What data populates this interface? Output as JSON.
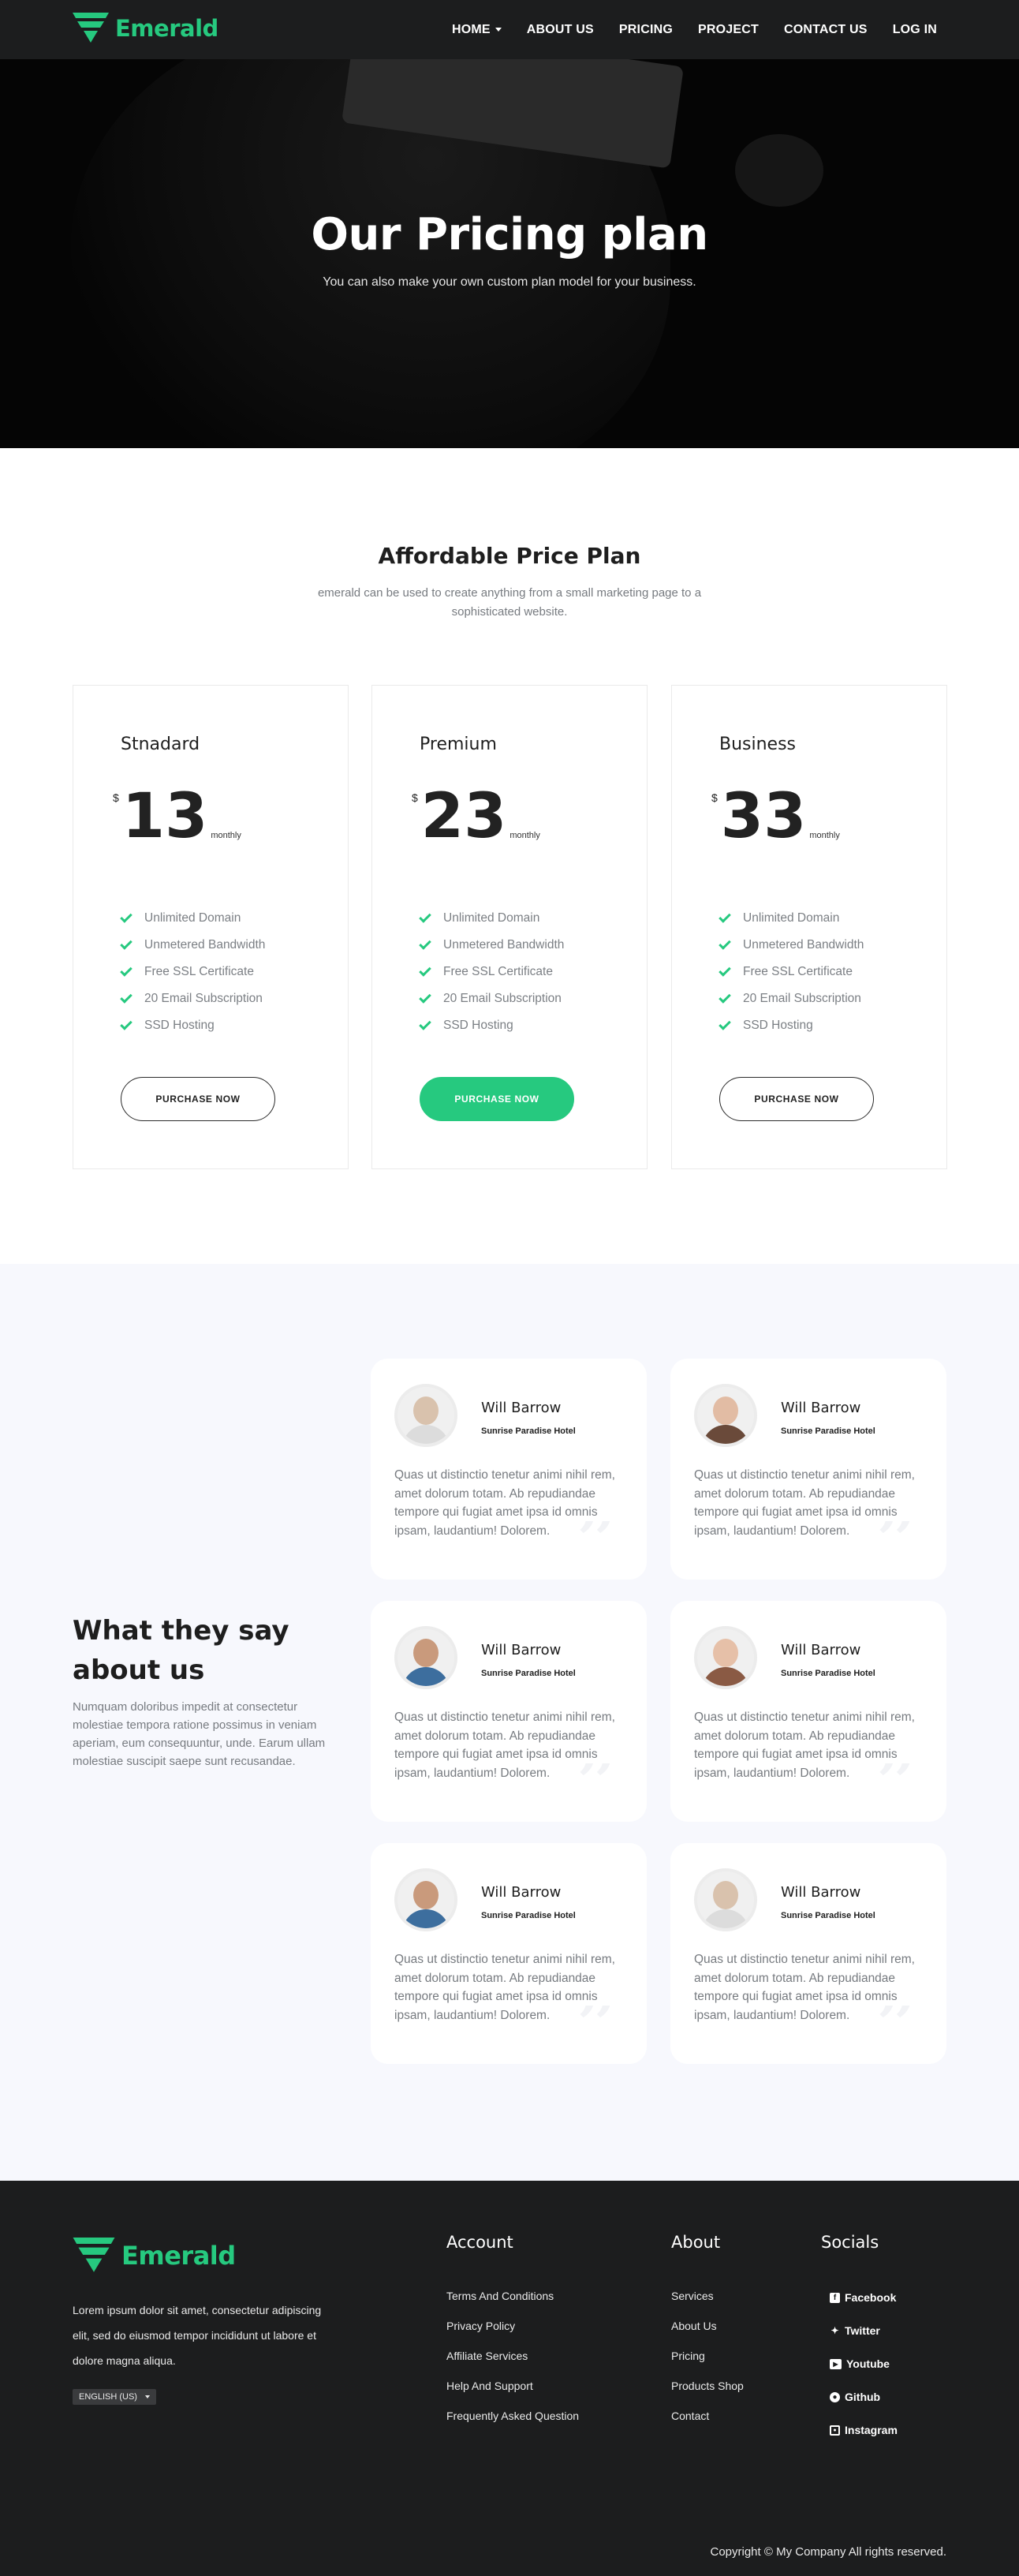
{
  "brand": {
    "name": "Emerald",
    "color": "#26c97f",
    "icon": "emerald-logo-icon"
  },
  "nav": {
    "items": [
      "HOME",
      "ABOUT US",
      "PRICING",
      "PROJECT",
      "CONTACT US",
      "LOG IN"
    ]
  },
  "hero": {
    "title": "Our Pricing plan",
    "subtitle": "You can also make your own custom plan model for your business."
  },
  "pricing": {
    "heading": "Affordable Price Plan",
    "description": "emerald can be used to create anything from a small marketing page to a sophisticated website.",
    "plans": [
      {
        "name": "Stnadard",
        "currency": "$",
        "amount": "13",
        "period": "monthly",
        "features": [
          "Unlimited Domain",
          "Unmetered Bandwidth",
          "Free SSL Certificate",
          "20 Email Subscription",
          "SSD Hosting"
        ],
        "button": "PURCHASE NOW",
        "highlight": false
      },
      {
        "name": "Premium",
        "currency": "$",
        "amount": "23",
        "period": "monthly",
        "features": [
          "Unlimited Domain",
          "Unmetered Bandwidth",
          "Free SSL Certificate",
          "20 Email Subscription",
          "SSD Hosting"
        ],
        "button": "PURCHASE NOW",
        "highlight": true
      },
      {
        "name": "Business",
        "currency": "$",
        "amount": "33",
        "period": "monthly",
        "features": [
          "Unlimited Domain",
          "Unmetered Bandwidth",
          "Free SSL Certificate",
          "20 Email Subscription",
          "SSD Hosting"
        ],
        "button": "PURCHASE NOW",
        "highlight": false
      }
    ]
  },
  "testimonials": {
    "title": "What they say about us",
    "description": "Numquam doloribus impedit at consectetur molestiae tempora ratione possimus in veniam aperiam, eum consequuntur, unde. Earum ullam molestiae suscipit saepe sunt recusandae.",
    "cards": [
      {
        "name": "Will Barrow",
        "hotel": "Sunrise Paradise Hotel",
        "quote": "Quas ut distinctio tenetur animi nihil rem, amet dolorum totam. Ab repudiandae tempore qui fugiat amet ipsa id omnis ipsam, laudantium! Dolorem.",
        "avatar": "person-avatar-1"
      },
      {
        "name": "Will Barrow",
        "hotel": "Sunrise Paradise Hotel",
        "quote": "Quas ut distinctio tenetur animi nihil rem, amet dolorum totam. Ab repudiandae tempore qui fugiat amet ipsa id omnis ipsam, laudantium! Dolorem.",
        "avatar": "person-avatar-2"
      },
      {
        "name": "Will Barrow",
        "hotel": "Sunrise Paradise Hotel",
        "quote": "Quas ut distinctio tenetur animi nihil rem, amet dolorum totam. Ab repudiandae tempore qui fugiat amet ipsa id omnis ipsam, laudantium! Dolorem.",
        "avatar": "person-avatar-3"
      },
      {
        "name": "Will Barrow",
        "hotel": "Sunrise Paradise Hotel",
        "quote": "Quas ut distinctio tenetur animi nihil rem, amet dolorum totam. Ab repudiandae tempore qui fugiat amet ipsa id omnis ipsam, laudantium! Dolorem.",
        "avatar": "person-avatar-4"
      },
      {
        "name": "Will Barrow",
        "hotel": "Sunrise Paradise Hotel",
        "quote": "Quas ut distinctio tenetur animi nihil rem, amet dolorum totam. Ab repudiandae tempore qui fugiat amet ipsa id omnis ipsam, laudantium! Dolorem.",
        "avatar": "person-avatar-5"
      },
      {
        "name": "Will Barrow",
        "hotel": "Sunrise Paradise Hotel",
        "quote": "Quas ut distinctio tenetur animi nihil rem, amet dolorum totam. Ab repudiandae tempore qui fugiat amet ipsa id omnis ipsam, laudantium! Dolorem.",
        "avatar": "person-avatar-6"
      }
    ]
  },
  "footer": {
    "about": "Lorem ipsum dolor sit amet, consectetur adipiscing elit, sed do eiusmod tempor incididunt ut labore et dolore magna aliqua.",
    "language": "ENGLISH (US)",
    "account": {
      "title": "Account",
      "links": [
        "Terms And Conditions",
        "Privacy Policy",
        "Affiliate Services",
        "Help And Support",
        "Frequently Asked Question"
      ]
    },
    "about_col": {
      "title": "About",
      "links": [
        "Services",
        "About Us",
        "Pricing",
        "Products Shop",
        "Contact"
      ]
    },
    "socials": {
      "title": "Socials",
      "links": [
        "Facebook",
        "Twitter",
        "Youtube",
        "Github",
        "Instagram"
      ]
    },
    "copyright": "Copyright © My Company All rights reserved."
  }
}
